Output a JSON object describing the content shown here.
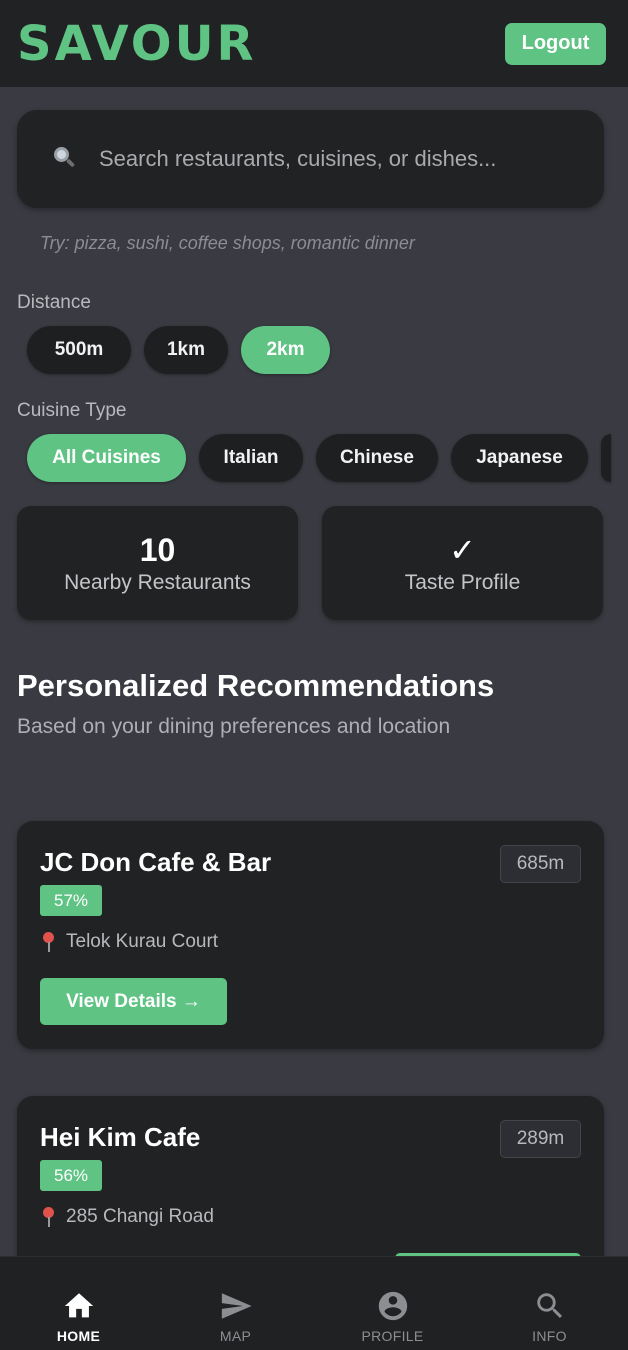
{
  "header": {
    "brand": "SAVOUR",
    "logout_label": "Logout"
  },
  "search": {
    "placeholder": "Search restaurants, cuisines, or dishes...",
    "hint": "Try: pizza, sushi, coffee shops, romantic dinner",
    "icon": "search-icon"
  },
  "distance": {
    "label": "Distance",
    "options": [
      "500m",
      "1km",
      "2km"
    ],
    "selected": "2km"
  },
  "cuisine": {
    "label": "Cuisine Type",
    "options": [
      "All Cuisines",
      "Italian",
      "Chinese",
      "Japanese"
    ],
    "selected": "All Cuisines"
  },
  "stats": {
    "nearby_count": "10",
    "nearby_label": "Nearby Restaurants",
    "taste_icon": "✓",
    "taste_label": "Taste Profile"
  },
  "recommendations": {
    "title": "Personalized Recommendations",
    "subtitle": "Based on your dining preferences and location",
    "items": [
      {
        "name": "JC Don Cafe & Bar",
        "distance": "685m",
        "match": "57%",
        "address": "Telok Kurau Court",
        "button": "View Details →"
      },
      {
        "name": "Hei Kim Cafe",
        "distance": "289m",
        "match": "56%",
        "address": "285 Changi Road"
      }
    ]
  },
  "nav": {
    "items": [
      {
        "label": "HOME",
        "icon": "home-icon"
      },
      {
        "label": "MAP",
        "icon": "send-icon"
      },
      {
        "label": "PROFILE",
        "icon": "account-circle-icon"
      },
      {
        "label": "INFO",
        "icon": "search-icon"
      }
    ],
    "active": "HOME"
  },
  "colors": {
    "accent": "#5fc384",
    "background": "#3a3b42",
    "surface": "#212224",
    "pin": "#e0524c"
  }
}
